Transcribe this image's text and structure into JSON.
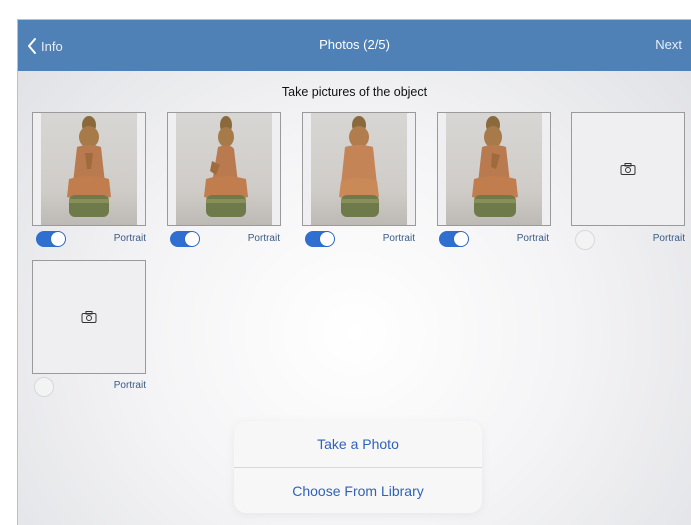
{
  "navbar": {
    "back_label": "Info",
    "title": "Photos (2/5)",
    "next_label": "Next",
    "color": "#4f81b6"
  },
  "subtitle": "Take pictures of the object",
  "photos": [
    {
      "has_image": true,
      "view": "front",
      "portrait_on": true,
      "label": "Portrait"
    },
    {
      "has_image": true,
      "view": "side",
      "portrait_on": true,
      "label": "Portrait"
    },
    {
      "has_image": true,
      "view": "back",
      "portrait_on": true,
      "label": "Portrait"
    },
    {
      "has_image": true,
      "view": "three-quarter",
      "portrait_on": true,
      "label": "Portrait"
    },
    {
      "has_image": false,
      "icon": "camera-icon",
      "portrait_on": false,
      "label": "Portrait"
    },
    {
      "has_image": false,
      "icon": "camera-icon",
      "portrait_on": false,
      "label": "Portrait"
    }
  ],
  "action_sheet": {
    "take_photo": "Take a Photo",
    "choose_library": "Choose From Library"
  },
  "accent": "#2f6fd0"
}
